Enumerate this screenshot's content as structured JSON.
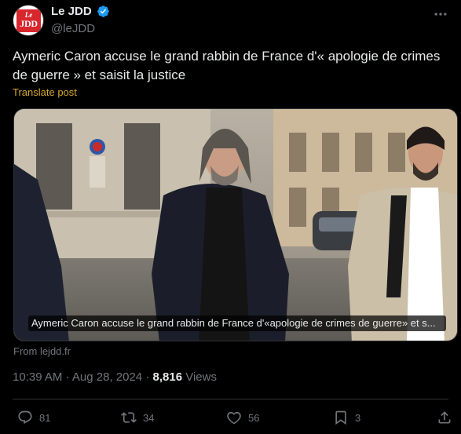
{
  "account": {
    "display_name": "Le JDD",
    "handle": "@leJDD",
    "logo_top": "Le",
    "logo_bottom": "JDD",
    "logo_color": "#d8262d",
    "verified_color": "#1d9bf0"
  },
  "tweet": {
    "text": "Aymeric Caron accuse le grand rabbin de France d'« apologie de crimes de guerre » et saisit la justice",
    "translate_label": "Translate post",
    "media_caption": "Aymeric Caron accuse le grand rabbin de France d'«apologie de crimes de guerre» et s...",
    "source": "From lejdd.fr",
    "time": "10:39 AM",
    "separator": "·",
    "date": "Aug 28, 2024",
    "views_count": "8,816",
    "views_label": "Views"
  },
  "actions": {
    "replies": "81",
    "reposts": "34",
    "likes": "56",
    "bookmarks": "3"
  },
  "icons": [
    "verified-badge-icon",
    "more-icon",
    "reply-icon",
    "repost-icon",
    "like-icon",
    "bookmark-icon",
    "share-icon"
  ]
}
